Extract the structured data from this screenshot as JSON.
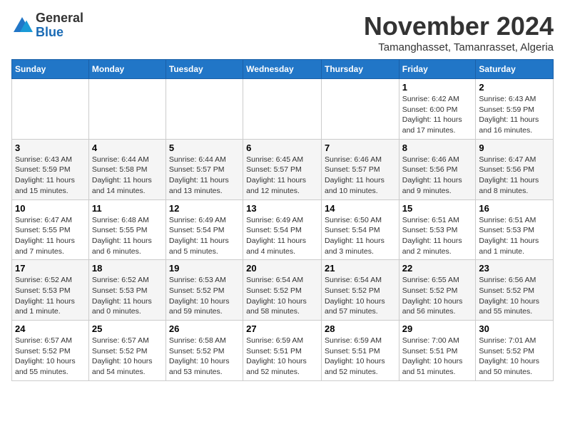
{
  "logo": {
    "general": "General",
    "blue": "Blue"
  },
  "header": {
    "month": "November 2024",
    "location": "Tamanghasset, Tamanrasset, Algeria"
  },
  "weekdays": [
    "Sunday",
    "Monday",
    "Tuesday",
    "Wednesday",
    "Thursday",
    "Friday",
    "Saturday"
  ],
  "weeks": [
    [
      {
        "day": "",
        "info": ""
      },
      {
        "day": "",
        "info": ""
      },
      {
        "day": "",
        "info": ""
      },
      {
        "day": "",
        "info": ""
      },
      {
        "day": "",
        "info": ""
      },
      {
        "day": "1",
        "info": "Sunrise: 6:42 AM\nSunset: 6:00 PM\nDaylight: 11 hours and 17 minutes."
      },
      {
        "day": "2",
        "info": "Sunrise: 6:43 AM\nSunset: 5:59 PM\nDaylight: 11 hours and 16 minutes."
      }
    ],
    [
      {
        "day": "3",
        "info": "Sunrise: 6:43 AM\nSunset: 5:59 PM\nDaylight: 11 hours and 15 minutes."
      },
      {
        "day": "4",
        "info": "Sunrise: 6:44 AM\nSunset: 5:58 PM\nDaylight: 11 hours and 14 minutes."
      },
      {
        "day": "5",
        "info": "Sunrise: 6:44 AM\nSunset: 5:57 PM\nDaylight: 11 hours and 13 minutes."
      },
      {
        "day": "6",
        "info": "Sunrise: 6:45 AM\nSunset: 5:57 PM\nDaylight: 11 hours and 12 minutes."
      },
      {
        "day": "7",
        "info": "Sunrise: 6:46 AM\nSunset: 5:57 PM\nDaylight: 11 hours and 10 minutes."
      },
      {
        "day": "8",
        "info": "Sunrise: 6:46 AM\nSunset: 5:56 PM\nDaylight: 11 hours and 9 minutes."
      },
      {
        "day": "9",
        "info": "Sunrise: 6:47 AM\nSunset: 5:56 PM\nDaylight: 11 hours and 8 minutes."
      }
    ],
    [
      {
        "day": "10",
        "info": "Sunrise: 6:47 AM\nSunset: 5:55 PM\nDaylight: 11 hours and 7 minutes."
      },
      {
        "day": "11",
        "info": "Sunrise: 6:48 AM\nSunset: 5:55 PM\nDaylight: 11 hours and 6 minutes."
      },
      {
        "day": "12",
        "info": "Sunrise: 6:49 AM\nSunset: 5:54 PM\nDaylight: 11 hours and 5 minutes."
      },
      {
        "day": "13",
        "info": "Sunrise: 6:49 AM\nSunset: 5:54 PM\nDaylight: 11 hours and 4 minutes."
      },
      {
        "day": "14",
        "info": "Sunrise: 6:50 AM\nSunset: 5:54 PM\nDaylight: 11 hours and 3 minutes."
      },
      {
        "day": "15",
        "info": "Sunrise: 6:51 AM\nSunset: 5:53 PM\nDaylight: 11 hours and 2 minutes."
      },
      {
        "day": "16",
        "info": "Sunrise: 6:51 AM\nSunset: 5:53 PM\nDaylight: 11 hours and 1 minute."
      }
    ],
    [
      {
        "day": "17",
        "info": "Sunrise: 6:52 AM\nSunset: 5:53 PM\nDaylight: 11 hours and 1 minute."
      },
      {
        "day": "18",
        "info": "Sunrise: 6:52 AM\nSunset: 5:53 PM\nDaylight: 11 hours and 0 minutes."
      },
      {
        "day": "19",
        "info": "Sunrise: 6:53 AM\nSunset: 5:52 PM\nDaylight: 10 hours and 59 minutes."
      },
      {
        "day": "20",
        "info": "Sunrise: 6:54 AM\nSunset: 5:52 PM\nDaylight: 10 hours and 58 minutes."
      },
      {
        "day": "21",
        "info": "Sunrise: 6:54 AM\nSunset: 5:52 PM\nDaylight: 10 hours and 57 minutes."
      },
      {
        "day": "22",
        "info": "Sunrise: 6:55 AM\nSunset: 5:52 PM\nDaylight: 10 hours and 56 minutes."
      },
      {
        "day": "23",
        "info": "Sunrise: 6:56 AM\nSunset: 5:52 PM\nDaylight: 10 hours and 55 minutes."
      }
    ],
    [
      {
        "day": "24",
        "info": "Sunrise: 6:57 AM\nSunset: 5:52 PM\nDaylight: 10 hours and 55 minutes."
      },
      {
        "day": "25",
        "info": "Sunrise: 6:57 AM\nSunset: 5:52 PM\nDaylight: 10 hours and 54 minutes."
      },
      {
        "day": "26",
        "info": "Sunrise: 6:58 AM\nSunset: 5:52 PM\nDaylight: 10 hours and 53 minutes."
      },
      {
        "day": "27",
        "info": "Sunrise: 6:59 AM\nSunset: 5:51 PM\nDaylight: 10 hours and 52 minutes."
      },
      {
        "day": "28",
        "info": "Sunrise: 6:59 AM\nSunset: 5:51 PM\nDaylight: 10 hours and 52 minutes."
      },
      {
        "day": "29",
        "info": "Sunrise: 7:00 AM\nSunset: 5:51 PM\nDaylight: 10 hours and 51 minutes."
      },
      {
        "day": "30",
        "info": "Sunrise: 7:01 AM\nSunset: 5:52 PM\nDaylight: 10 hours and 50 minutes."
      }
    ]
  ]
}
